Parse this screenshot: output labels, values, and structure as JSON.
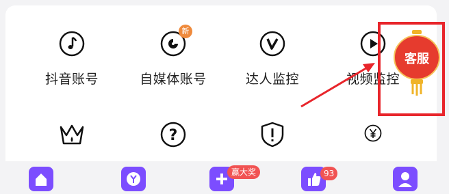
{
  "menu": {
    "row1": [
      {
        "label": "抖音账号",
        "icon": "music-note-icon"
      },
      {
        "label": "自媒体账号",
        "icon": "pie-play-icon",
        "badge": "新"
      },
      {
        "label": "达人监控",
        "icon": "v-icon"
      },
      {
        "label": "视频监控",
        "icon": "play-icon"
      }
    ],
    "row2": [
      {
        "icon": "crown-icon"
      },
      {
        "icon": "question-icon"
      },
      {
        "icon": "shield-alert-icon"
      },
      {
        "icon": "yen-icon"
      }
    ]
  },
  "customer_service": {
    "label": "客服"
  },
  "annotation": {
    "color": "#e8252b"
  },
  "tabbar": {
    "items": [
      {
        "icon": "home-icon"
      },
      {
        "icon": "yen-wallet-icon"
      },
      {
        "icon": "plus-icon",
        "badge": "赢大奖"
      },
      {
        "icon": "thumbs-up-icon",
        "badge": "93"
      },
      {
        "icon": "profile-icon"
      }
    ]
  },
  "colors": {
    "accent_purple": "#7c4dff",
    "badge_red": "#f15353",
    "new_badge": "#ef8a3c"
  }
}
